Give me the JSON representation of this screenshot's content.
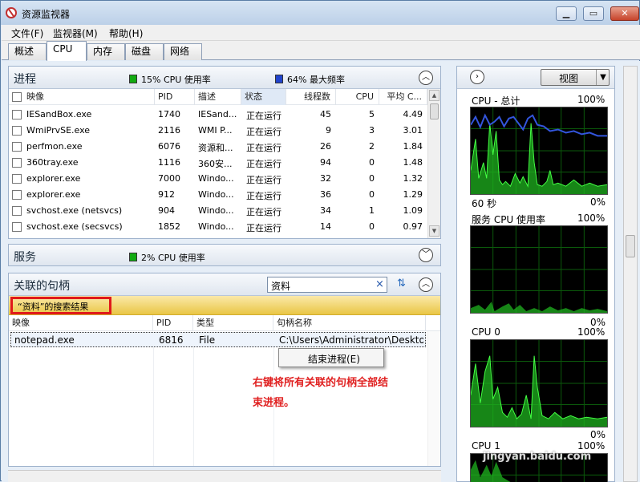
{
  "window": {
    "title": "资源监视器"
  },
  "menu": [
    "文件(F)",
    "监视器(M)",
    "帮助(H)"
  ],
  "tabs": [
    "概述",
    "CPU",
    "内存",
    "磁盘",
    "网络"
  ],
  "active_tab": "CPU",
  "processes": {
    "title": "进程",
    "legend_cpu": "15% CPU 使用率",
    "legend_freq": "64% 最大频率",
    "columns": [
      "映像",
      "PID",
      "描述",
      "状态",
      "线程数",
      "CPU",
      "平均 C..."
    ],
    "rows": [
      {
        "image": "IESandBox.exe",
        "pid": "1740",
        "desc": "IESand...",
        "status": "正在运行",
        "threads": "45",
        "cpu": "5",
        "avg": "4.49"
      },
      {
        "image": "WmiPrvSE.exe",
        "pid": "2116",
        "desc": "WMI P...",
        "status": "正在运行",
        "threads": "9",
        "cpu": "3",
        "avg": "3.01"
      },
      {
        "image": "perfmon.exe",
        "pid": "6076",
        "desc": "资源和...",
        "status": "正在运行",
        "threads": "26",
        "cpu": "2",
        "avg": "1.84"
      },
      {
        "image": "360tray.exe",
        "pid": "1116",
        "desc": "360安...",
        "status": "正在运行",
        "threads": "94",
        "cpu": "0",
        "avg": "1.48"
      },
      {
        "image": "explorer.exe",
        "pid": "7000",
        "desc": "Windo...",
        "status": "正在运行",
        "threads": "32",
        "cpu": "0",
        "avg": "1.32"
      },
      {
        "image": "explorer.exe",
        "pid": "912",
        "desc": "Windo...",
        "status": "正在运行",
        "threads": "36",
        "cpu": "0",
        "avg": "1.29"
      },
      {
        "image": "svchost.exe (netsvcs)",
        "pid": "904",
        "desc": "Windo...",
        "status": "正在运行",
        "threads": "34",
        "cpu": "1",
        "avg": "1.09"
      },
      {
        "image": "svchost.exe (secsvcs)",
        "pid": "1852",
        "desc": "Windo...",
        "status": "正在运行",
        "threads": "14",
        "cpu": "0",
        "avg": "0.97"
      }
    ]
  },
  "services": {
    "title": "服务",
    "legend_cpu": "2% CPU 使用率"
  },
  "handles": {
    "title": "关联的句柄",
    "search_value": "资料",
    "results_label": "“资料”的搜索结果",
    "columns": [
      "映像",
      "PID",
      "类型",
      "句柄名称"
    ],
    "rows": [
      {
        "image": "notepad.exe",
        "pid": "6816",
        "type": "File",
        "name": "C:\\Users\\Administrator\\Desktop..."
      }
    ],
    "context_menu_item": "结束进程(E)"
  },
  "annotation": {
    "line1": "右键将所有关联的句柄全部结",
    "line2": "束进程。"
  },
  "right_panel": {
    "view_label": "视图",
    "graphs": [
      {
        "title": "CPU - 总计",
        "max": "100%",
        "time": "60 秒",
        "min": "0%"
      },
      {
        "title": "服务 CPU 使用率",
        "max": "100%",
        "min": "0%"
      },
      {
        "title": "CPU 0",
        "max": "100%",
        "min": "0%"
      },
      {
        "title": "CPU 1",
        "max": "100%"
      }
    ]
  },
  "watermark": {
    "text": "jingyan.baidu.com"
  },
  "colors": {
    "graph_bg": "#000000",
    "graph_fill": "#1fb31f",
    "graph_line": "#00ff00",
    "freq_line": "#3355dd",
    "highlight": "#e8c340",
    "annotation": "#e02020"
  }
}
